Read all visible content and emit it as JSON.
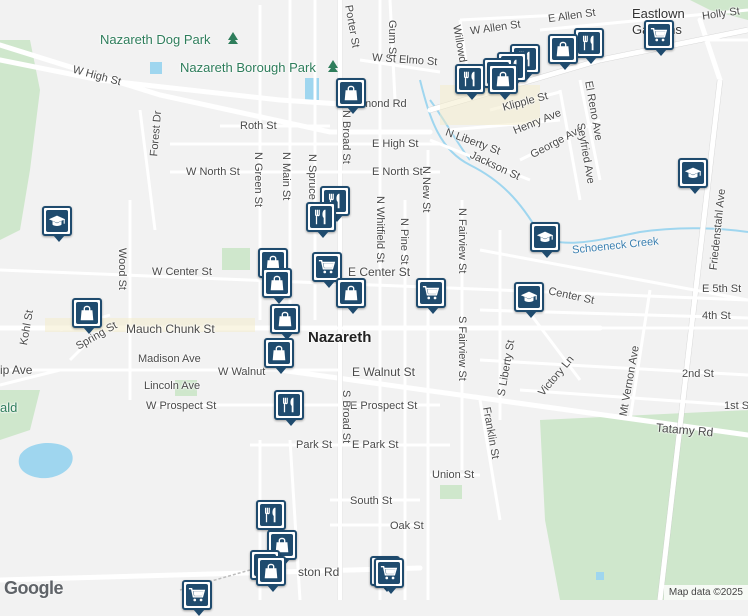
{
  "map": {
    "parks": [
      "Nazareth Dog Park",
      "Nazareth Borough Park"
    ],
    "town": "Nazareth",
    "places": [
      "Eastlown",
      "Gardens",
      "ald"
    ],
    "streets": [
      "W Allen St",
      "E Allen St",
      "Holly St",
      "W St Elmo St",
      "Willowd",
      "Gum St",
      "Porter St",
      "N Broad St",
      "W High St",
      "Forest Dr",
      "Roth St",
      "E High St",
      "N Liberty St",
      "Jackson St",
      "George Ave",
      "Henry Ave",
      "Klipple St",
      "El Reno Ave",
      "Seyfried Ave",
      "W North St",
      "E North St",
      "N Green St",
      "N Main St",
      "N Spruce",
      "N Whitfield St",
      "N Pine St",
      "N New St",
      "N Fairview St",
      "Schoeneck Creek",
      "Friedenstahl Ave",
      "W Center St",
      "E Center St",
      "Wood St",
      "E 5th St",
      "Center St",
      "4th St",
      "Mauch Chunk St",
      "Kohl St",
      "Spring St",
      "Madison Ave",
      "W Walnut",
      "E Walnut St",
      "Lincoln Ave",
      "W Prospect St",
      "E Prospect St",
      "S Fairview St",
      "S Liberty St",
      "Victory Ln",
      "Mt Vernon Ave",
      "2nd St",
      "1st S",
      "Tatamy Rd",
      "Franklin St",
      "S Broad St",
      "Park St",
      "E Park St",
      "Union St",
      "South St",
      "Oak St",
      "ston Rd",
      "ip Ave",
      "mond Rd"
    ]
  },
  "pins": [
    {
      "icon": "grocery-icon"
    },
    {
      "icon": "restaurant-icon"
    },
    {
      "icon": "shopping-icon"
    },
    {
      "icon": "restaurant-icon"
    },
    {
      "icon": "restaurant-icon"
    },
    {
      "icon": "restaurant-icon"
    },
    {
      "icon": "shopping-icon"
    },
    {
      "icon": "restaurant-icon"
    },
    {
      "icon": "school-icon"
    },
    {
      "icon": "school-icon"
    },
    {
      "icon": "school-icon"
    },
    {
      "icon": "school-icon"
    },
    {
      "icon": "grocery-icon"
    },
    {
      "icon": "grocery-icon"
    },
    {
      "icon": "shopping-icon"
    },
    {
      "icon": "shopping-icon"
    },
    {
      "icon": "shopping-icon"
    },
    {
      "icon": "shopping-icon"
    },
    {
      "icon": "shopping-icon"
    },
    {
      "icon": "restaurant-icon"
    },
    {
      "icon": "restaurant-icon"
    },
    {
      "icon": "shopping-icon"
    },
    {
      "icon": "grocery-icon"
    },
    {
      "icon": "grocery-icon"
    }
  ],
  "footer": {
    "logo": "Google",
    "attribution": "Map data ©2025"
  },
  "colors": {
    "pin_border": "#1f4b6e",
    "water": "#9fd6ef",
    "park": "#c8e6c9"
  }
}
